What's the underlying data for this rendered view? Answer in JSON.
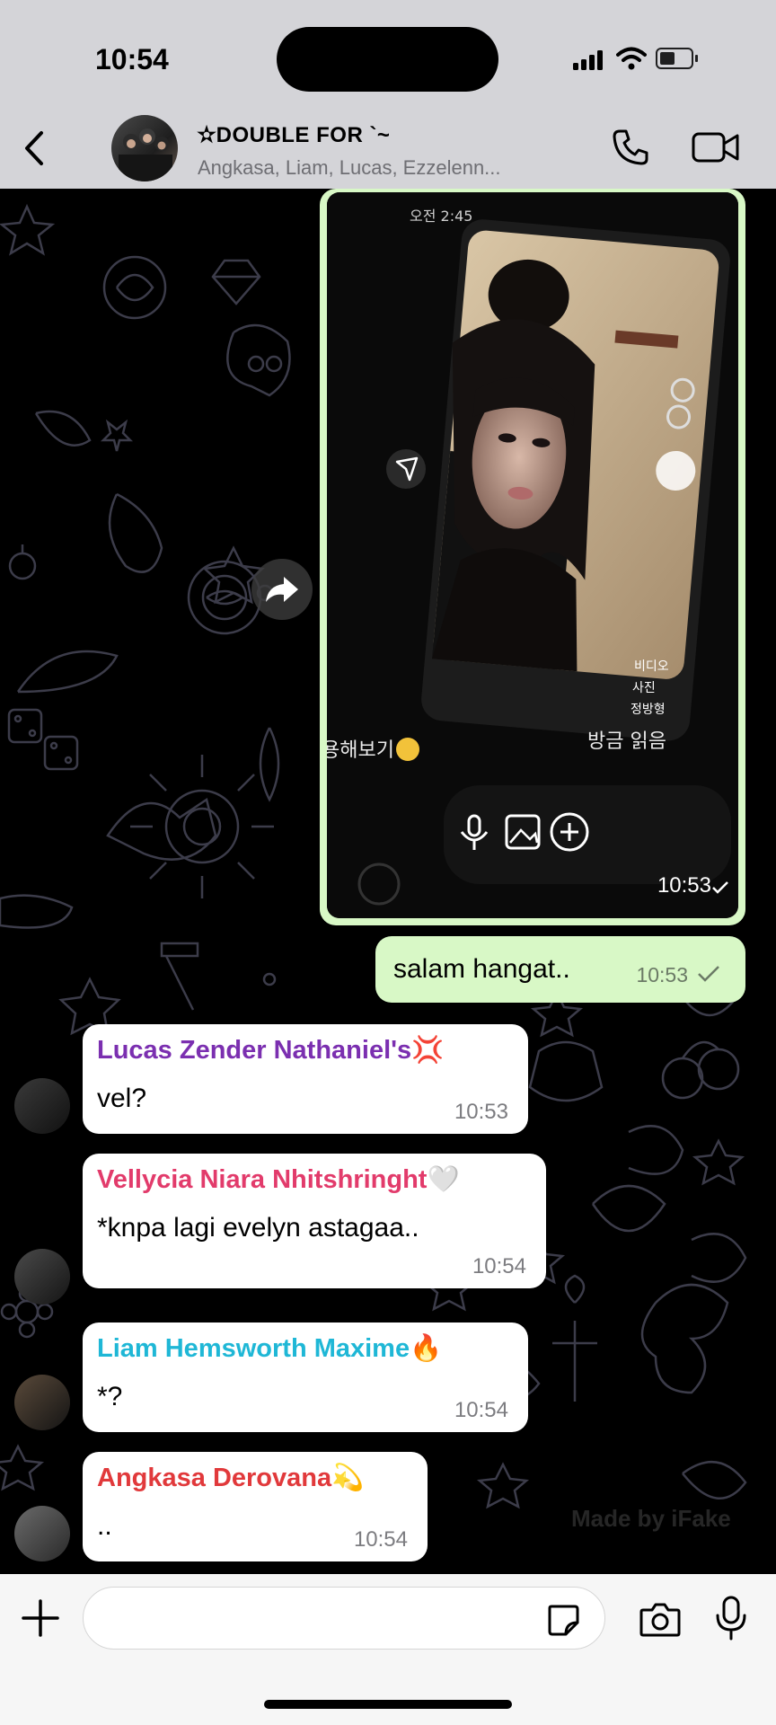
{
  "status_bar": {
    "time": "10:54"
  },
  "header": {
    "title": "✫DOUBLE FOR `~",
    "members": "Angkasa, Liam, Lucas, Ezzelenn..."
  },
  "photo_message": {
    "screen": {
      "clock": "오전 2:45",
      "read_receipt": "방금 읽음",
      "hint_text": "용해보기",
      "menu": [
        "비디오",
        "사진",
        "정방형"
      ]
    },
    "time": "10:53"
  },
  "outgoing": {
    "text": "salam hangat..",
    "time": "10:53"
  },
  "messages": [
    {
      "name": "Lucas Zender Nathaniel's💢",
      "name_color": "#7b2fb0",
      "text": "vel?",
      "time": "10:53"
    },
    {
      "name": "Vellycia Niara Nhitshringht🤍",
      "name_color": "#e23b6b",
      "text": "*knpa lagi evelyn astagaa..",
      "time": "10:54"
    },
    {
      "name": "Liam Hemsworth Maxime🔥",
      "name_color": "#1fb7d6",
      "text": "*?",
      "time": "10:54"
    },
    {
      "name": "Angkasa Derovana💫",
      "name_color": "#e1393b",
      "text": "..",
      "time": "10:54"
    }
  ],
  "watermark": "Made by iFake",
  "colors": {
    "bubble_out": "#d8f8c6",
    "bubble_in": "#ffffff",
    "bar": "#d4d4d8"
  },
  "icons": [
    "back-chevron-icon",
    "phone-icon",
    "video-camera-icon",
    "forward-icon",
    "plus-icon",
    "sticker-icon",
    "camera-icon",
    "microphone-icon"
  ]
}
